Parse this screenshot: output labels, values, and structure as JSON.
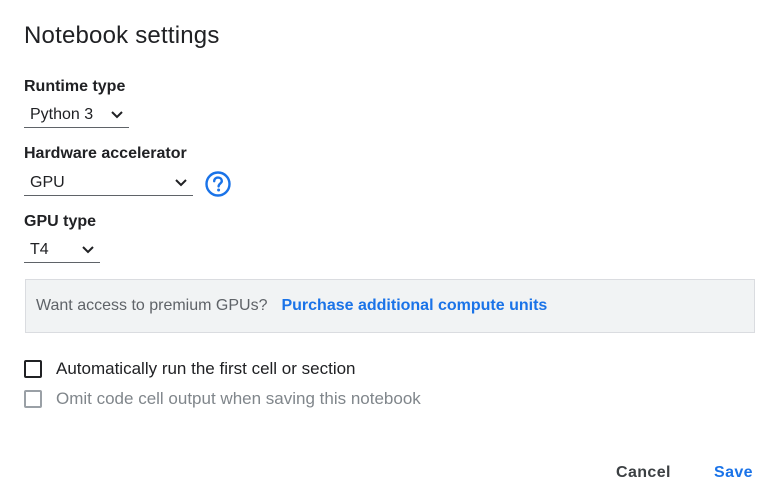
{
  "dialog": {
    "title": "Notebook settings"
  },
  "runtime": {
    "label": "Runtime type",
    "value": "Python 3"
  },
  "accelerator": {
    "label": "Hardware accelerator",
    "value": "GPU",
    "help_icon": "help-circle-icon"
  },
  "gpu": {
    "label": "GPU type",
    "value": "T4"
  },
  "promo": {
    "text": "Want access to premium GPUs?",
    "link": "Purchase additional compute units"
  },
  "options": [
    {
      "label": "Automatically run the first cell or section",
      "checked": false,
      "disabled": false
    },
    {
      "label": "Omit code cell output when saving this notebook",
      "checked": false,
      "disabled": true
    }
  ],
  "actions": {
    "cancel": "Cancel",
    "save": "Save"
  },
  "colors": {
    "accent": "#1a73e8",
    "text": "#202124",
    "muted": "#5f6368",
    "promo_bg": "#f1f3f4"
  }
}
